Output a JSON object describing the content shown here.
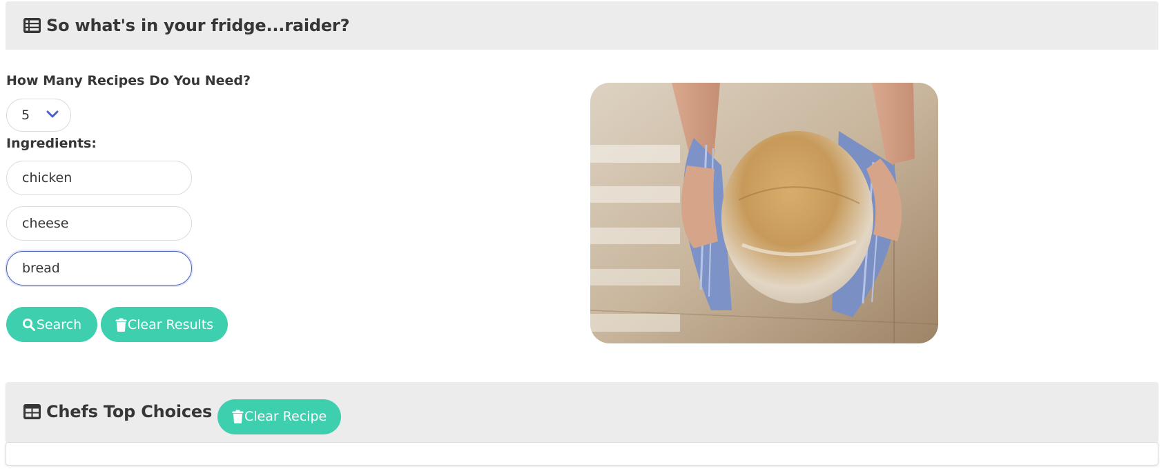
{
  "header": {
    "title": "So what's in your fridge...raider?",
    "icon": "list-icon"
  },
  "form": {
    "recipes_label": "How Many Recipes Do You Need?",
    "recipes_count": "5",
    "ingredients_label": "Ingredients:",
    "ingredients": [
      "chicken",
      "cheese",
      "bread"
    ]
  },
  "buttons": {
    "search": "Search",
    "clear_results": "Clear Results",
    "clear_recipe": "Clear Recipe"
  },
  "results": {
    "title": "Chefs Top Choices",
    "icon": "table-icon"
  },
  "colors": {
    "accent": "#3ecfae",
    "header_bg": "#ececec",
    "focus": "#485fc7",
    "chevron": "#485fc7"
  }
}
